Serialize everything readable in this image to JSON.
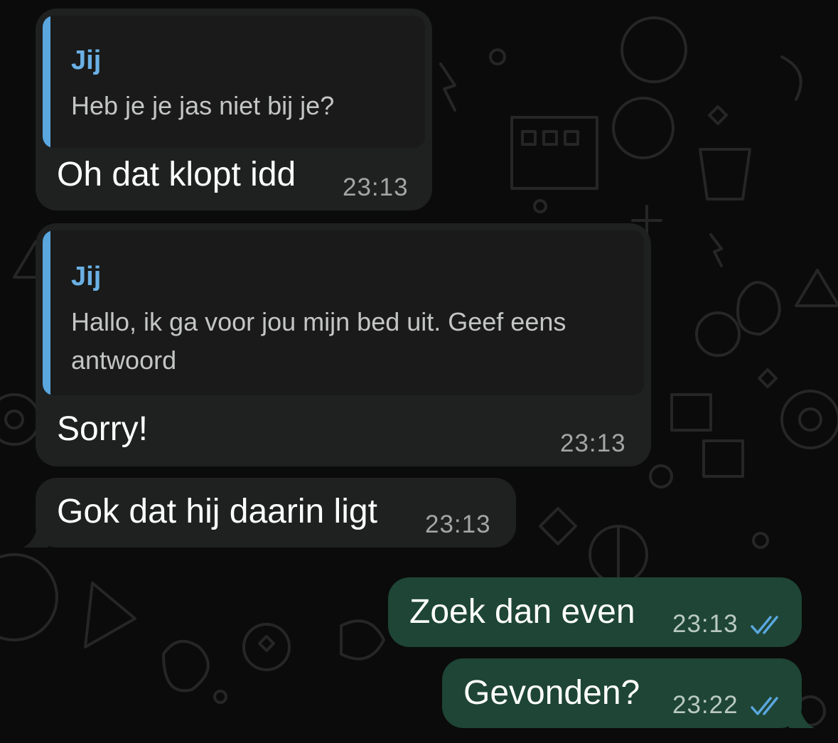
{
  "messages": [
    {
      "direction": "incoming",
      "reply_to": {
        "author": "Jij",
        "text": "Heb je je jas niet bij je?"
      },
      "text": "Oh dat klopt idd",
      "time": "23:13"
    },
    {
      "direction": "incoming",
      "reply_to": {
        "author": "Jij",
        "text_line1": "Hallo, ik ga voor jou mijn bed uit. Geef eens",
        "text_line2": "antwoord"
      },
      "text": "Sorry!",
      "time": "23:13"
    },
    {
      "direction": "incoming",
      "text": "Gok dat hij daarin ligt",
      "time": "23:13"
    },
    {
      "direction": "outgoing",
      "text": "Zoek dan even",
      "time": "23:13",
      "status_icon": "double-check-read-icon"
    },
    {
      "direction": "outgoing",
      "text": "Gevonden?",
      "time": "23:22",
      "status_icon": "double-check-read-icon"
    }
  ],
  "colors": {
    "background": "#0b0b0b",
    "incoming_bubble": "#1f2120",
    "outgoing_bubble": "#1e4535",
    "quote_bar": "#5aa6de",
    "quote_author": "#6ab0e4",
    "read_ticks": "#5aa6de"
  }
}
